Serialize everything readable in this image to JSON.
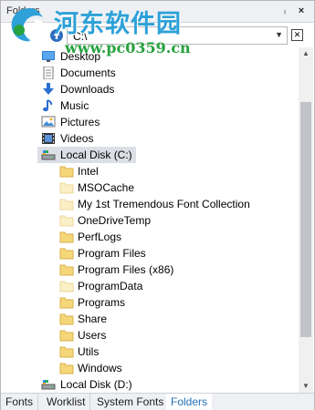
{
  "window": {
    "title": "Folders",
    "pin_glyph": "⨾",
    "close_glyph": "×"
  },
  "watermark": {
    "title": "河东软件园",
    "url": "www.pc0359.cn"
  },
  "pathbar": {
    "up_icon": "up-arrow-icon",
    "path": "C:\\",
    "dropdown_glyph": "▼",
    "clear_glyph": "✕"
  },
  "tree": {
    "items": [
      {
        "label": "Desktop",
        "icon": "desktop-icon"
      },
      {
        "label": "Documents",
        "icon": "documents-icon"
      },
      {
        "label": "Downloads",
        "icon": "downloads-icon"
      },
      {
        "label": "Music",
        "icon": "music-icon"
      },
      {
        "label": "Pictures",
        "icon": "pictures-icon"
      },
      {
        "label": "Videos",
        "icon": "videos-icon"
      },
      {
        "label": "Local Disk (C:)",
        "icon": "drive-icon",
        "selected": true
      },
      {
        "label": "Intel",
        "icon": "folder-icon"
      },
      {
        "label": "MSOCache",
        "icon": "folder-faded-icon"
      },
      {
        "label": "My 1st Tremendous Font Collection",
        "icon": "folder-faded-icon"
      },
      {
        "label": "OneDriveTemp",
        "icon": "folder-faded-icon"
      },
      {
        "label": "PerfLogs",
        "icon": "folder-icon"
      },
      {
        "label": "Program Files",
        "icon": "folder-icon"
      },
      {
        "label": "Program Files (x86)",
        "icon": "folder-icon"
      },
      {
        "label": "ProgramData",
        "icon": "folder-faded-icon"
      },
      {
        "label": "Programs",
        "icon": "folder-icon"
      },
      {
        "label": "Share",
        "icon": "folder-icon"
      },
      {
        "label": "Users",
        "icon": "folder-icon"
      },
      {
        "label": "Utils",
        "icon": "folder-icon"
      },
      {
        "label": "Windows",
        "icon": "folder-icon"
      },
      {
        "label": "Local Disk (D:)",
        "icon": "drive-icon"
      }
    ]
  },
  "scrollbar": {
    "up_glyph": "▲",
    "down_glyph": "▼"
  },
  "tabs": [
    {
      "label": "Fonts"
    },
    {
      "label": "Worklist"
    },
    {
      "label": "System Fonts"
    },
    {
      "label": "Folders",
      "active": true
    }
  ],
  "colors": {
    "accent": "#1f6fb5",
    "folder": "#f5d77a",
    "folder_faded": "#fbefc6",
    "selection": "#dcdfe5",
    "watermark_title": "#2da1d8",
    "watermark_url": "#26a23e"
  }
}
